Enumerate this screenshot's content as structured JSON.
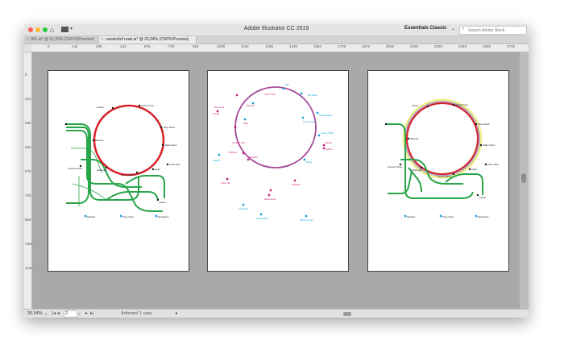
{
  "app": {
    "title": "Adobe Illustrator CC 2019",
    "workspace": "Essentials Classic",
    "search_placeholder": "Search Adobe Stock"
  },
  "tabs": [
    {
      "label": "001.ai* @ 51,02% (CMYK/Preview)",
      "active": false
    },
    {
      "label": "vanderfull road.ai* @ 26,94% (CMYK/Preview)",
      "active": true
    }
  ],
  "ruler": {
    "top_ticks": [
      "0",
      "144",
      "288",
      "432",
      "576",
      "720",
      "864",
      "1008",
      "1152",
      "1296",
      "1440",
      "1584",
      "1728",
      "1872",
      "2016",
      "2160",
      "2304",
      "2448",
      "2592",
      "2736"
    ],
    "left_ticks": [
      "0",
      "144",
      "288",
      "432",
      "576",
      "720",
      "864",
      "1008",
      "1152"
    ]
  },
  "status": {
    "zoom": "26,94%",
    "page": "2",
    "artboard_name": "Artboard 1 copy"
  },
  "icons": {
    "close": "close-icon",
    "home": "home-icon",
    "search": "search-icon"
  },
  "colors": {
    "red_line": "#d82027",
    "green_line": "#2aa54a",
    "purple_line": "#a64a9a",
    "cyan_dot": "#1ba1d6",
    "magenta_dot": "#c8217e"
  },
  "artboard1": {
    "labels": [
      "Oxford Circus",
      "Bond Street",
      "Baker Street",
      "Green Park",
      "Angel",
      "Covent Garden",
      "Paddington",
      "Liverpool Street",
      "Waterloo",
      "Victoria",
      "Euston",
      "Elephant",
      "Kings Cross",
      "Marylebone"
    ]
  },
  "artboard2": {
    "labels": [
      "Monument",
      "Temple",
      "Mile End",
      "Bank",
      "Kings Cross",
      "Old Street",
      "Canada Water",
      "Finsbury Park",
      "Canary Wharf",
      "Brixton",
      "Holborn",
      "Camden Town",
      "Barbican",
      "Stratford",
      "Aldgate",
      "Euston",
      "Tower Hill",
      "Shadwell",
      "Westminster",
      "Southwark",
      "Whitechapel",
      "Bethnal Green",
      "Bow"
    ]
  },
  "artboard3": {
    "labels": [
      "Oxford Circus",
      "Bond Street",
      "Baker Street",
      "Green Park",
      "Angel",
      "Covent Garden",
      "Paddington",
      "Liverpool Street",
      "Waterloo",
      "Victoria",
      "Euston",
      "Elephant",
      "Kings Cross",
      "Marylebone"
    ]
  }
}
